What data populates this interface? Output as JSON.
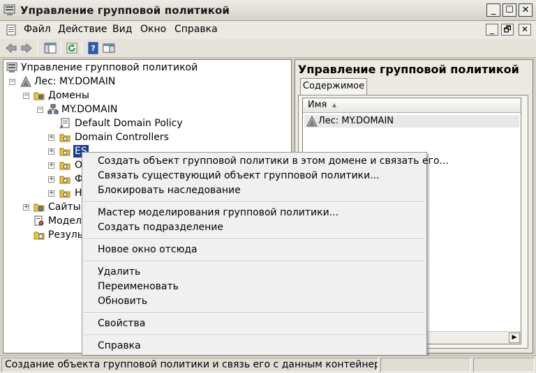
{
  "window": {
    "title": "Управление групповой политикой",
    "minimize": "_",
    "maximize": "☐",
    "close": "✕"
  },
  "menu": {
    "items": [
      "Файл",
      "Действие",
      "Вид",
      "Окно",
      "Справка"
    ],
    "mdi_minimize": "_",
    "mdi_restore": "🗗",
    "mdi_close": "✕"
  },
  "tree": {
    "root": "Управление групповой политикой",
    "forest": "Лес: MY.DOMAIN",
    "domains": "Домены",
    "domain": "MY.DOMAIN",
    "default_policy": "Default Domain Policy",
    "domain_controllers": "Domain Controllers",
    "selected_ou": "ES",
    "ou_o": "О",
    "ou_f": "Ф",
    "ou_n": "Н",
    "sites": "Сайты",
    "modeling": "Модели",
    "results": "Результ",
    "expand_symbol": "+",
    "collapse_symbol": "−"
  },
  "right_pane": {
    "title": "Управление групповой политикой",
    "tab": "Содержимое",
    "column": "Имя",
    "sort_glyph": "▲",
    "row": "Лес: MY.DOMAIN",
    "scroll_right": "▶"
  },
  "context_menu": {
    "group1": [
      "Создать объект групповой политики в этом домене и связать его...",
      "Связать существующий объект групповой политики...",
      "Блокировать наследование"
    ],
    "group2": [
      "Мастер моделирования групповой политики...",
      "Создать подразделение"
    ],
    "group3": [
      "Новое окно отсюда"
    ],
    "group4": [
      "Удалить",
      "Переименовать",
      "Обновить"
    ],
    "group5": [
      "Свойства"
    ],
    "group6": [
      "Справка"
    ]
  },
  "status": {
    "text": "Создание объекта групповой политики и связь его с данным контейнером"
  },
  "colors": {
    "selection": "#1a3d8f",
    "folder": "#e8c24a",
    "accent_help": "#2d5fb8"
  }
}
